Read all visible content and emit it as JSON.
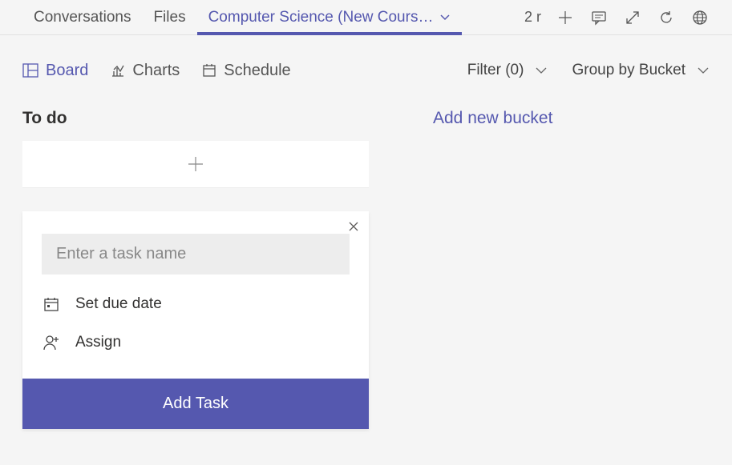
{
  "topTabs": {
    "conversations": "Conversations",
    "files": "Files",
    "active": "Computer Science (New Cours…"
  },
  "topRight": {
    "tabCount": "2 r"
  },
  "viewTabs": {
    "board": "Board",
    "charts": "Charts",
    "schedule": "Schedule"
  },
  "toolbar": {
    "filter": "Filter (0)",
    "groupBy": "Group by Bucket"
  },
  "bucket": {
    "todo": "To do"
  },
  "newTask": {
    "placeholder": "Enter a task name",
    "setDueDate": "Set due date",
    "assign": "Assign",
    "addTask": "Add Task"
  },
  "addBucket": "Add new bucket"
}
